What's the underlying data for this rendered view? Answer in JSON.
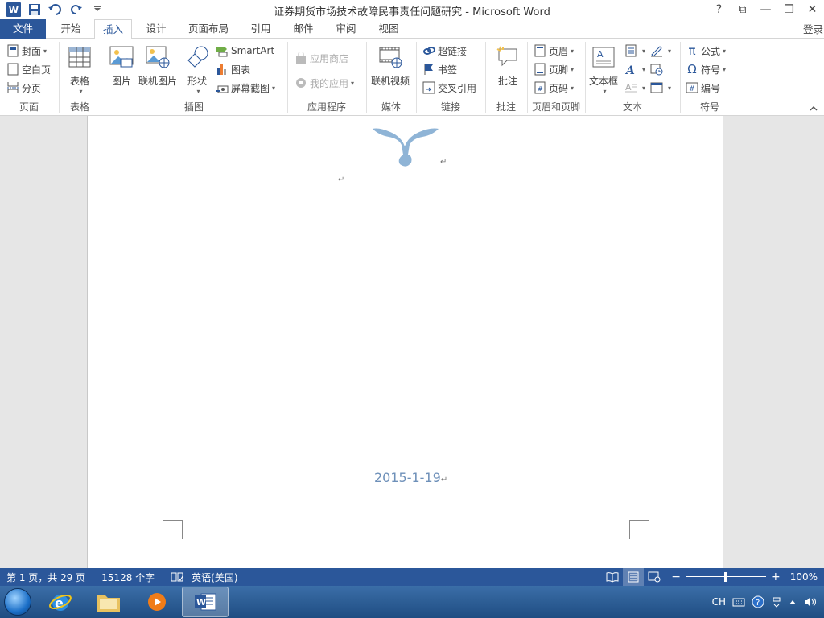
{
  "window": {
    "title": "证券期货市场技术故障民事责任问题研究 - Microsoft Word",
    "controls": [
      "?",
      "⧉",
      "—",
      "❐",
      "✕"
    ]
  },
  "qat": {
    "word_icon_label": "W"
  },
  "tabs": {
    "file": "文件",
    "items": [
      "开始",
      "插入",
      "设计",
      "页面布局",
      "引用",
      "邮件",
      "审阅",
      "视图"
    ],
    "active": "插入",
    "login": "登录"
  },
  "ribbon": {
    "pages": {
      "label": "页面",
      "cover": "封面",
      "blank": "空白页",
      "break": "分页"
    },
    "tables": {
      "label": "表格",
      "table": "表格"
    },
    "illustrations": {
      "label": "插图",
      "picture": "图片",
      "online_picture": "联机图片",
      "shapes": "形状",
      "smartart": "SmartArt",
      "chart": "图表",
      "screenshot": "屏幕截图"
    },
    "apps": {
      "label": "应用程序",
      "store": "应用商店",
      "my_apps": "我的应用"
    },
    "media": {
      "label": "媒体",
      "online_video": "联机视频"
    },
    "links": {
      "label": "链接",
      "hyperlink": "超链接",
      "bookmark": "书签",
      "cross_ref": "交叉引用"
    },
    "comments": {
      "label": "批注",
      "comment": "批注"
    },
    "header_footer": {
      "label": "页眉和页脚",
      "header": "页眉",
      "footer": "页脚",
      "page_number": "页码"
    },
    "text": {
      "label": "文本",
      "textbox": "文本框"
    },
    "symbols": {
      "label": "符号",
      "equation": "公式",
      "symbol": "符号",
      "number": "编号"
    }
  },
  "document": {
    "date": "2015-1-19",
    "para_mark": "↵"
  },
  "status": {
    "page": "第 1 页，共 29 页",
    "words": "15128 个字",
    "language": "英语(美国)",
    "zoom": "100%",
    "zoom_fraction": 0.5
  },
  "taskbar": {
    "tray": {
      "lang": "CH"
    }
  },
  "colors": {
    "accent": "#2b579a",
    "date": "#6e90b9",
    "logo": "#8fb4d6"
  }
}
